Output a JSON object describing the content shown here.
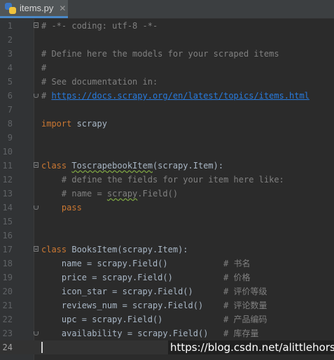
{
  "tab": {
    "label": "items.py",
    "close": "✕"
  },
  "lines": [
    {
      "n": "1",
      "segments": [
        {
          "t": "# -*- coding: utf-8 -*-",
          "c": "cmt"
        }
      ]
    },
    {
      "n": "2",
      "segments": []
    },
    {
      "n": "3",
      "segments": [
        {
          "t": "# Define here the models for your scraped items",
          "c": "cmt"
        }
      ]
    },
    {
      "n": "4",
      "segments": [
        {
          "t": "#",
          "c": "cmt"
        }
      ]
    },
    {
      "n": "5",
      "segments": [
        {
          "t": "# See documentation in:",
          "c": "cmt"
        }
      ]
    },
    {
      "n": "6",
      "segments": [
        {
          "t": "# ",
          "c": "cmt"
        },
        {
          "t": "https://docs.scrapy.org/en/latest/topics/items.html",
          "c": "url"
        }
      ]
    },
    {
      "n": "7",
      "segments": []
    },
    {
      "n": "8",
      "segments": [
        {
          "t": "import",
          "c": "kw"
        },
        {
          "t": " scrapy",
          "c": ""
        }
      ]
    },
    {
      "n": "9",
      "segments": []
    },
    {
      "n": "10",
      "segments": []
    },
    {
      "n": "11",
      "segments": [
        {
          "t": "class",
          "c": "kw"
        },
        {
          "t": " ",
          "c": ""
        },
        {
          "t": "ToscrapebookItem",
          "c": "warn"
        },
        {
          "t": "(scrapy.Item):",
          "c": ""
        }
      ]
    },
    {
      "n": "12",
      "segments": [
        {
          "t": "    # define the fields for your item here like:",
          "c": "cmt"
        }
      ]
    },
    {
      "n": "13",
      "segments": [
        {
          "t": "    # name = ",
          "c": "cmt"
        },
        {
          "t": "scrapy",
          "c": "cmt warn"
        },
        {
          "t": ".Field()",
          "c": "cmt"
        }
      ]
    },
    {
      "n": "14",
      "segments": [
        {
          "t": "    ",
          "c": ""
        },
        {
          "t": "pass",
          "c": "kw"
        }
      ]
    },
    {
      "n": "15",
      "segments": []
    },
    {
      "n": "16",
      "segments": []
    },
    {
      "n": "17",
      "segments": [
        {
          "t": "class",
          "c": "kw"
        },
        {
          "t": " BooksItem(scrapy.Item):",
          "c": ""
        }
      ]
    },
    {
      "n": "18",
      "segments": [
        {
          "t": "    name = scrapy.Field()           ",
          "c": ""
        },
        {
          "t": "# 书名",
          "c": "cmt"
        }
      ]
    },
    {
      "n": "19",
      "segments": [
        {
          "t": "    price = scrapy.Field()          ",
          "c": ""
        },
        {
          "t": "# 价格",
          "c": "cmt"
        }
      ]
    },
    {
      "n": "20",
      "segments": [
        {
          "t": "    icon_star = scrapy.Field()      ",
          "c": ""
        },
        {
          "t": "# 评价等级",
          "c": "cmt"
        }
      ]
    },
    {
      "n": "21",
      "segments": [
        {
          "t": "    reviews_num = scrapy.Field()    ",
          "c": ""
        },
        {
          "t": "# 评论数量",
          "c": "cmt"
        }
      ]
    },
    {
      "n": "22",
      "segments": [
        {
          "t": "    upc = scrapy.Field()            ",
          "c": ""
        },
        {
          "t": "# 产品编码",
          "c": "cmt"
        }
      ]
    },
    {
      "n": "23",
      "segments": [
        {
          "t": "    availability = scrapy.Field()   ",
          "c": ""
        },
        {
          "t": "# 库存量",
          "c": "cmt"
        }
      ]
    },
    {
      "n": "24",
      "segments": []
    }
  ],
  "watermark": "https://blog.csdn.net/alittlehorse"
}
